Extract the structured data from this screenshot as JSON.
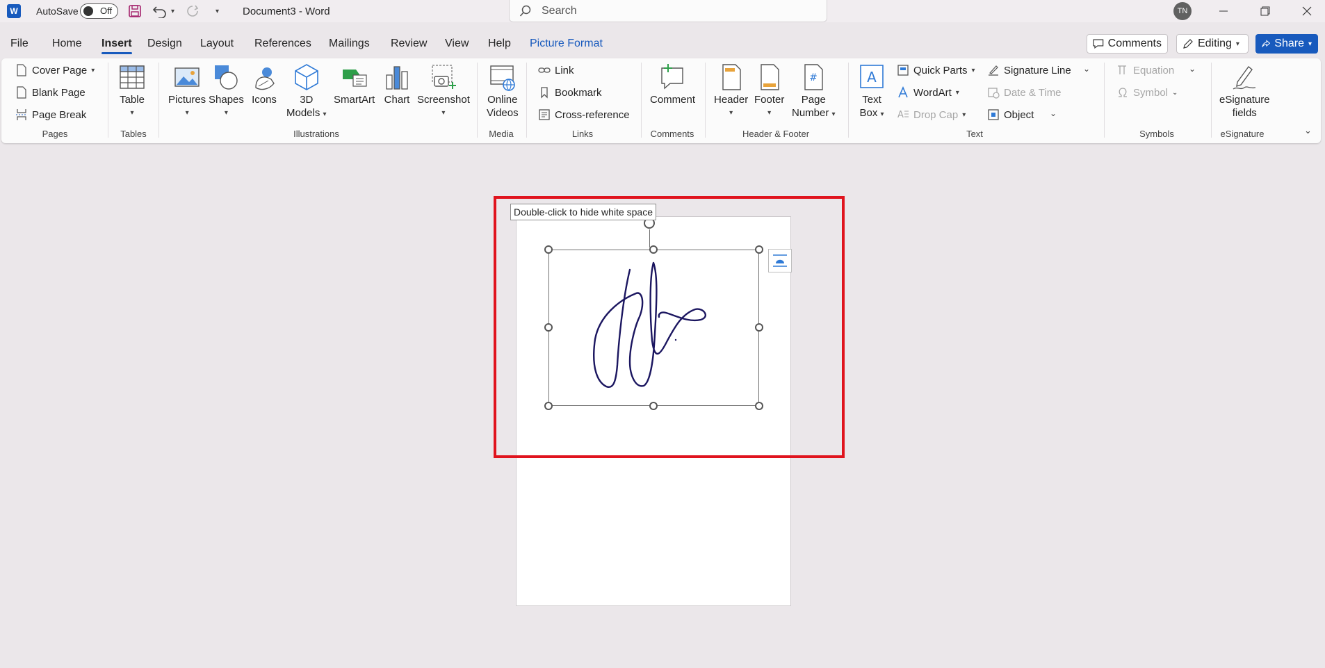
{
  "titlebar": {
    "app_icon": "word-logo-icon",
    "autosave_label": "AutoSave",
    "autosave_state": "Off",
    "document_title": "Document3  -  Word",
    "search_placeholder": "Search",
    "user_initials": "TN"
  },
  "tabs": [
    {
      "label": "File"
    },
    {
      "label": "Home"
    },
    {
      "label": "Insert",
      "active": true
    },
    {
      "label": "Design"
    },
    {
      "label": "Layout"
    },
    {
      "label": "References"
    },
    {
      "label": "Mailings"
    },
    {
      "label": "Review"
    },
    {
      "label": "View"
    },
    {
      "label": "Help"
    },
    {
      "label": "Picture Format"
    }
  ],
  "top_right": {
    "comments_label": "Comments",
    "editing_label": "Editing",
    "share_label": "Share"
  },
  "ribbon": {
    "pages": {
      "label": "Pages",
      "cover_page": "Cover Page",
      "blank_page": "Blank Page",
      "page_break": "Page Break"
    },
    "tables": {
      "label": "Tables",
      "table": "Table"
    },
    "illustrations": {
      "label": "Illustrations",
      "pictures": "Pictures",
      "shapes": "Shapes",
      "icons": "Icons",
      "models_line1": "3D",
      "models_line2": "Models",
      "smartart": "SmartArt",
      "chart": "Chart",
      "screenshot": "Screenshot"
    },
    "media": {
      "label": "Media",
      "online_line1": "Online",
      "online_line2": "Videos"
    },
    "links": {
      "label": "Links",
      "link": "Link",
      "bookmark": "Bookmark",
      "cross_reference": "Cross-reference"
    },
    "comments": {
      "label": "Comments",
      "comment": "Comment"
    },
    "header_footer": {
      "label": "Header & Footer",
      "header": "Header",
      "footer": "Footer",
      "page_line1": "Page",
      "page_line2": "Number"
    },
    "text": {
      "label": "Text",
      "textbox_line1": "Text",
      "textbox_line2": "Box",
      "quick_parts": "Quick Parts",
      "wordart": "WordArt",
      "drop_cap": "Drop Cap",
      "signature_line": "Signature Line",
      "date_time": "Date & Time",
      "object": "Object"
    },
    "symbols": {
      "label": "Symbols",
      "equation": "Equation",
      "symbol": "Symbol"
    },
    "esignature": {
      "label": "eSignature",
      "fields_line1": "eSignature",
      "fields_line2": "fields"
    }
  },
  "canvas": {
    "tooltip": "Double-click to hide white space",
    "image": "handwritten-signature"
  },
  "colors": {
    "accent": "#185abd",
    "highlight": "#e0141e",
    "signature_ink": "#1b1660"
  }
}
